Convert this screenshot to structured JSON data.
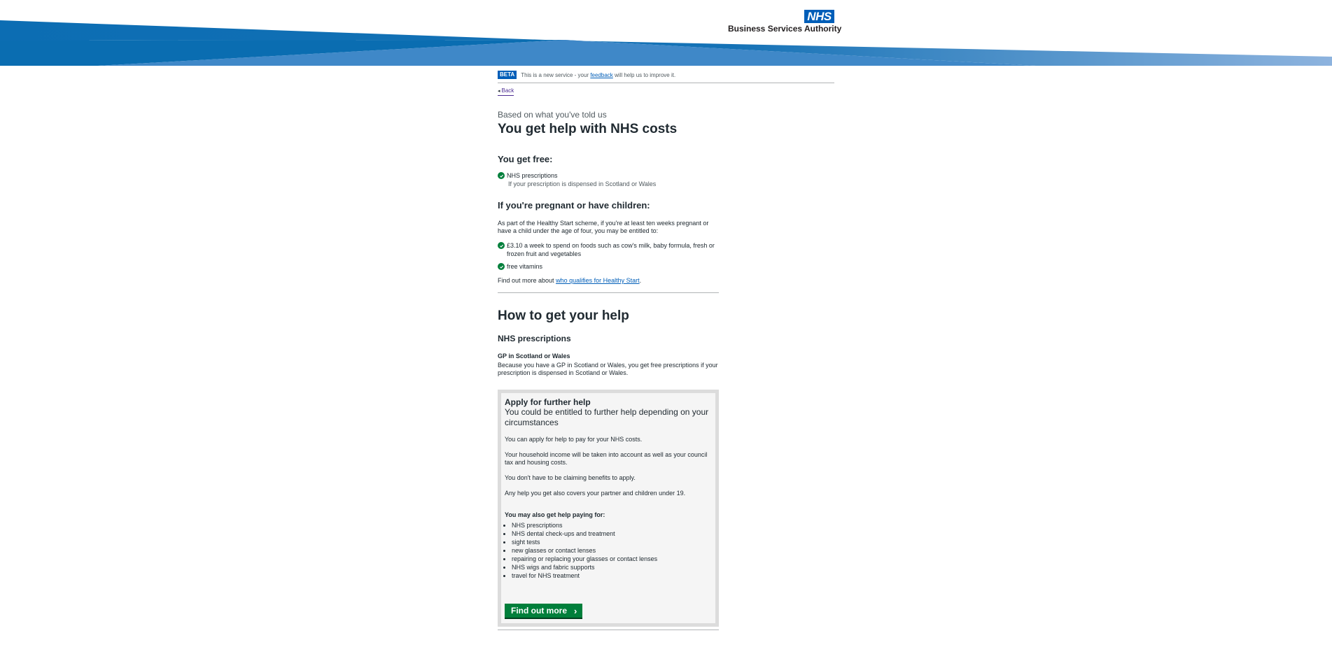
{
  "header": {
    "logo_text": "NHS",
    "org_name": "Business Services Authority",
    "band_colors": [
      "#1572b6",
      "#0a6db1",
      "#4d8fcc",
      "#8db3de"
    ]
  },
  "beta": {
    "tag": "BETA",
    "text_before": "This is a new service - your ",
    "link": "feedback",
    "text_after": " will help us to improve it."
  },
  "back": {
    "label": "Back"
  },
  "result": {
    "caption": "Based on what you've told us",
    "title": "You get help with NHS costs",
    "free_heading": "You get free:",
    "free_items": [
      {
        "label": "NHS prescriptions",
        "note": "If your prescription is dispensed in Scotland or Wales"
      }
    ],
    "pregnant_heading": "If you're pregnant or have children:",
    "pregnant_intro": "As part of the Healthy Start scheme, if you're at least ten weeks pregnant or have a child under the age of four, you may be entitled to:",
    "pregnant_items": [
      "£3.10 a week to spend on foods such as cow's milk, baby formula, fresh or frozen fruit and vegetables",
      "free vitamins"
    ],
    "find_out_before": "Find out more about ",
    "find_out_link": "who qualifies for Healthy Start",
    "find_out_after": "."
  },
  "how": {
    "title": "How to get your help",
    "prescriptions_heading": "NHS prescriptions",
    "gp_heading": "GP in Scotland or Wales",
    "gp_text": "Because you have a GP in Scotland or Wales, you get free prescriptions if your prescription is dispensed in Scotland or Wales."
  },
  "panel": {
    "title": "Apply for further help",
    "subtitle": "You could be entitled to further help depending on your circumstances",
    "paragraphs": [
      "You can apply for help to pay for your NHS costs.",
      "Your household income will be taken into account as well as your council tax and housing costs.",
      "You don't have to be claiming benefits to apply.",
      "Any help you get also covers your partner and children under 19."
    ],
    "list_heading": "You may also get help paying for:",
    "list": [
      "NHS prescriptions",
      "NHS dental check-ups and treatment",
      "sight tests",
      "new glasses or contact lenses",
      "repairing or replacing your glasses or contact lenses",
      "NHS wigs and fabric supports",
      "travel for NHS treatment"
    ],
    "button": "Find out more"
  }
}
